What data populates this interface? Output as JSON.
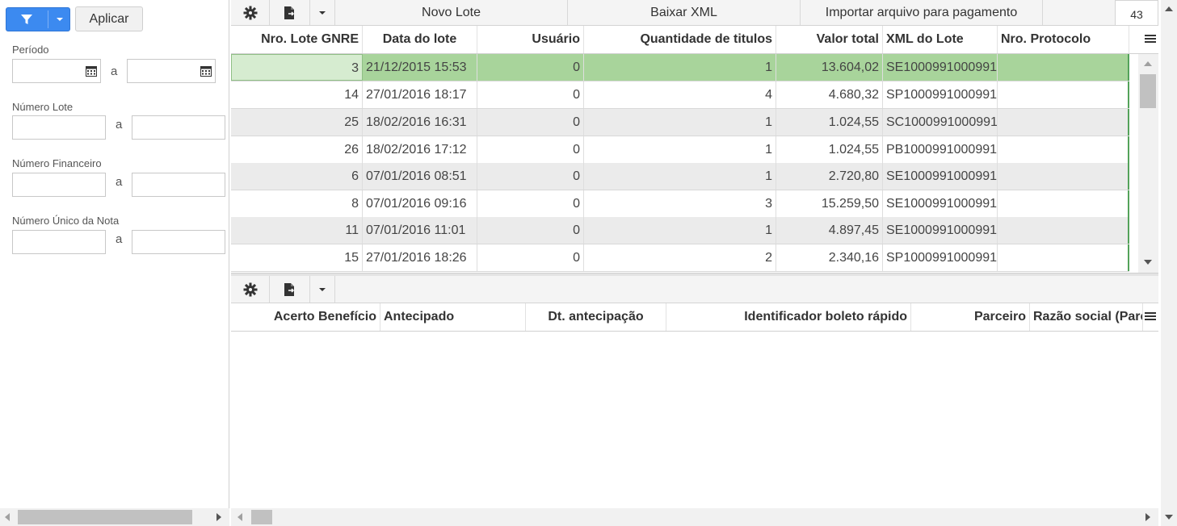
{
  "filters": {
    "apply_label": "Aplicar",
    "periodo_label": "Período",
    "numero_lote_label": "Número Lote",
    "numero_financeiro_label": "Número Financeiro",
    "numero_unico_label": "Número Único da Nota",
    "range_sep": "a",
    "periodo_from": "",
    "periodo_to": "",
    "lote_from": "",
    "lote_to": "",
    "fin_from": "",
    "fin_to": "",
    "nota_from": "",
    "nota_to": ""
  },
  "top_toolbar": {
    "novo_lote": "Novo Lote",
    "baixar_xml": "Baixar XML",
    "importar": "Importar arquivo para pagamento",
    "count": "43"
  },
  "top_grid": {
    "columns": [
      "Nro. Lote GNRE",
      "Data do lote",
      "Usuário",
      "Quantidade de titulos",
      "Valor total",
      "XML do Lote",
      "Nro. Protocolo"
    ],
    "rows": [
      {
        "lote": "3",
        "data": "21/12/2015 15:53",
        "usuario": "0",
        "qtd": "1",
        "valor": "13.604,02",
        "xml": "SE1000991000991",
        "protocolo": ""
      },
      {
        "lote": "14",
        "data": "27/01/2016 18:17",
        "usuario": "0",
        "qtd": "4",
        "valor": "4.680,32",
        "xml": "SP1000991000991",
        "protocolo": ""
      },
      {
        "lote": "25",
        "data": "18/02/2016 16:31",
        "usuario": "0",
        "qtd": "1",
        "valor": "1.024,55",
        "xml": "SC1000991000991",
        "protocolo": ""
      },
      {
        "lote": "26",
        "data": "18/02/2016 17:12",
        "usuario": "0",
        "qtd": "1",
        "valor": "1.024,55",
        "xml": "PB1000991000991",
        "protocolo": ""
      },
      {
        "lote": "6",
        "data": "07/01/2016 08:51",
        "usuario": "0",
        "qtd": "1",
        "valor": "2.720,80",
        "xml": "SE1000991000991",
        "protocolo": ""
      },
      {
        "lote": "8",
        "data": "07/01/2016 09:16",
        "usuario": "0",
        "qtd": "3",
        "valor": "15.259,50",
        "xml": "SE1000991000991",
        "protocolo": ""
      },
      {
        "lote": "11",
        "data": "07/01/2016 11:01",
        "usuario": "0",
        "qtd": "1",
        "valor": "4.897,45",
        "xml": "SE1000991000991",
        "protocolo": ""
      },
      {
        "lote": "15",
        "data": "27/01/2016 18:26",
        "usuario": "0",
        "qtd": "2",
        "valor": "2.340,16",
        "xml": "SP1000991000991",
        "protocolo": ""
      }
    ]
  },
  "bottom_grid": {
    "columns": [
      "Acerto Benefício",
      "Antecipado",
      "Dt. antecipação",
      "Identificador boleto rápido",
      "Parceiro",
      "Razão social (Parc"
    ]
  },
  "colors": {
    "accent_blue": "#3c8af0",
    "selected_row": "#a8d49b",
    "alt_row": "#ebebeb"
  }
}
